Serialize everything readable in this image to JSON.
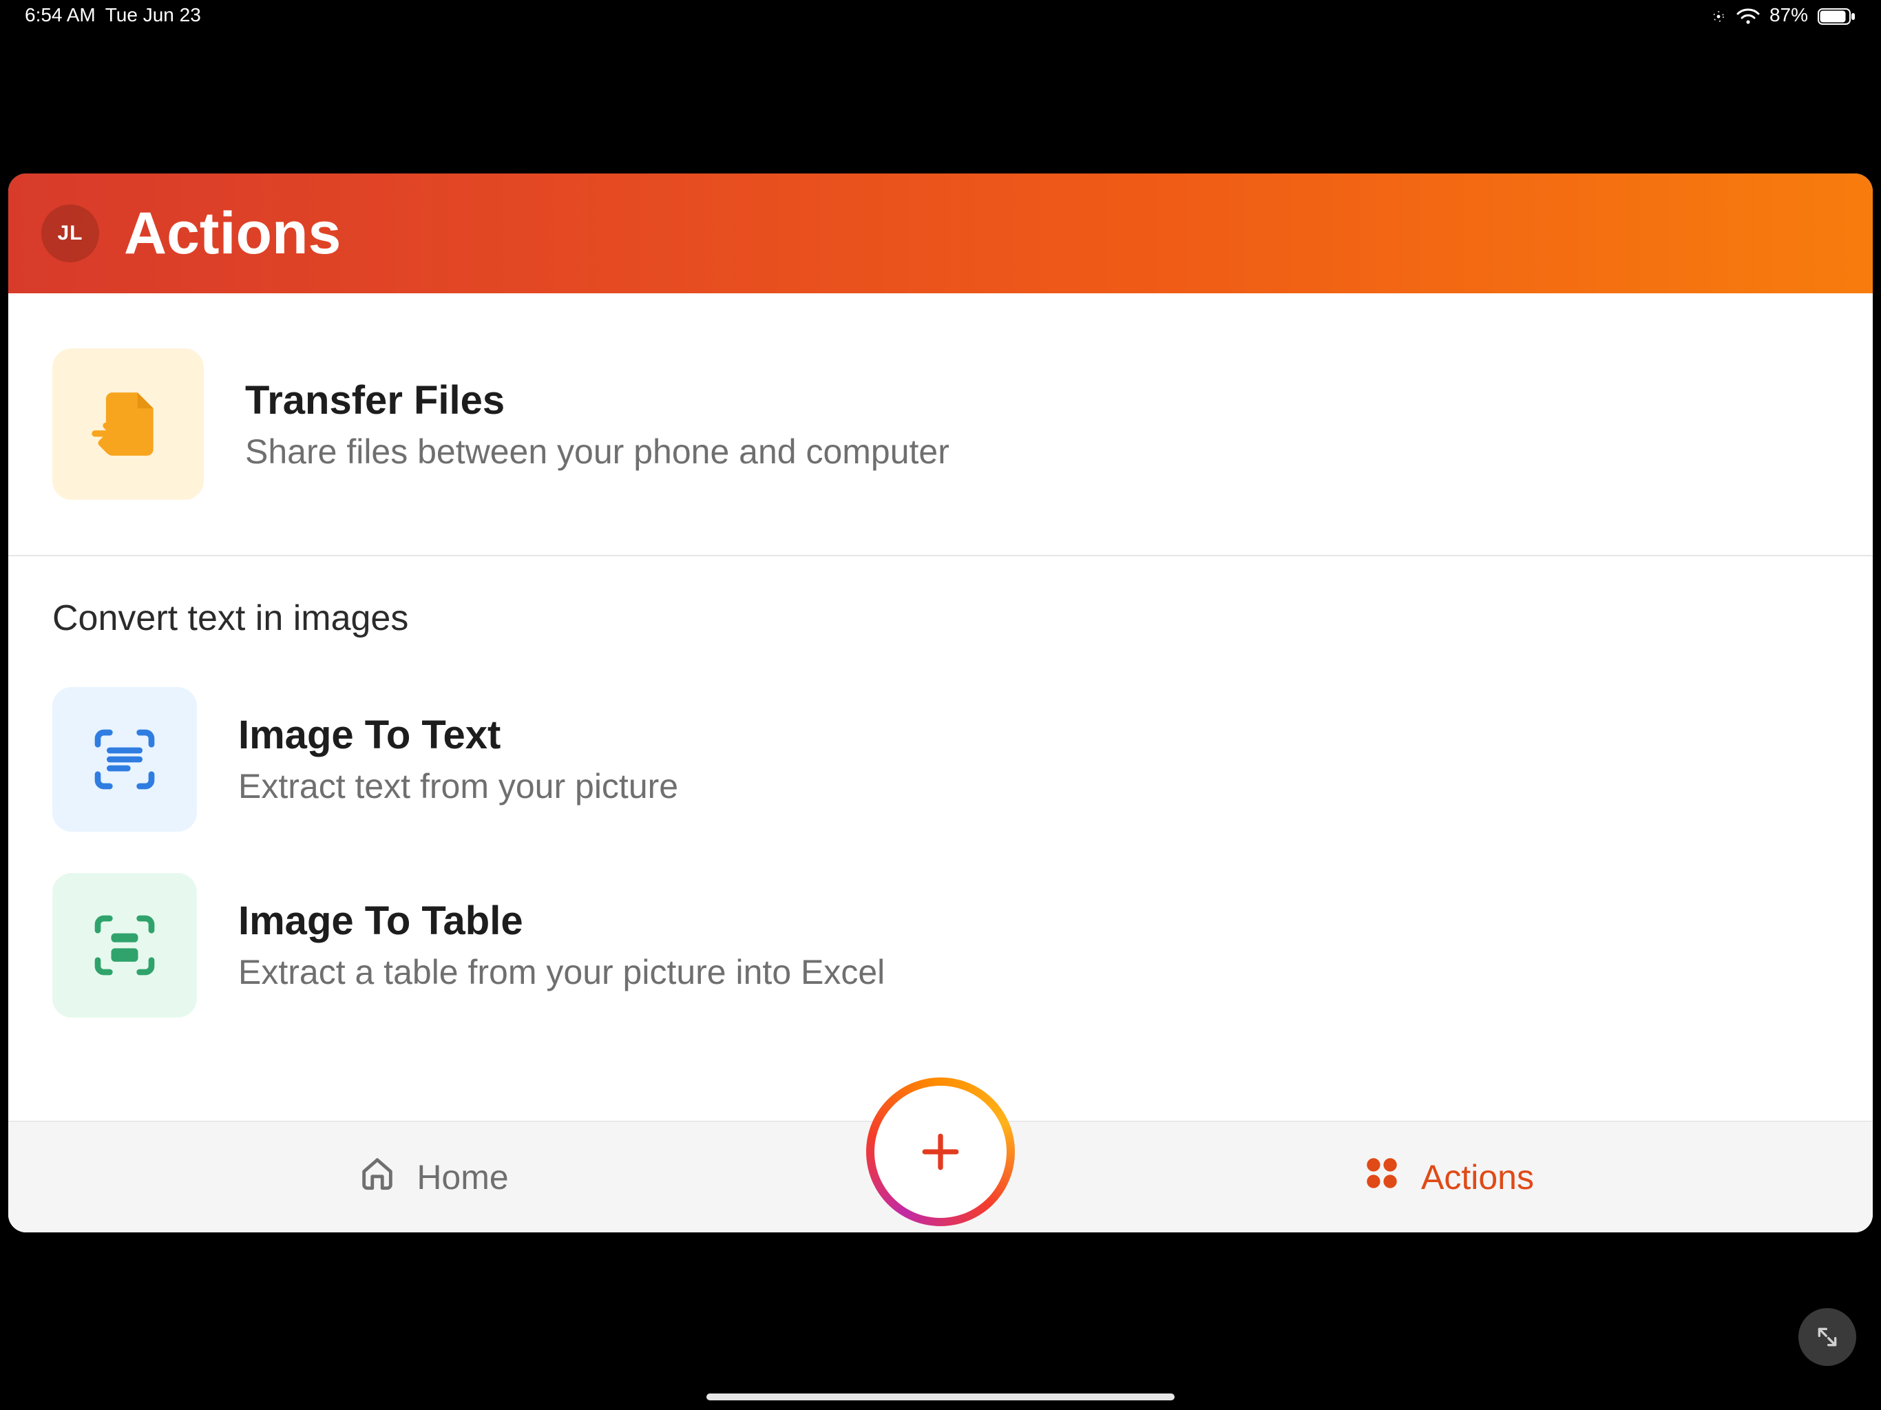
{
  "status_bar": {
    "time": "6:54 AM",
    "date": "Tue Jun 23",
    "battery_pct": "87%"
  },
  "header": {
    "avatar_initials": "JL",
    "title": "Actions"
  },
  "sections": {
    "share": {
      "items": [
        {
          "title": "Transfer Files",
          "subtitle": "Share files between your phone and computer",
          "icon": "transfer-icon"
        }
      ]
    },
    "convert": {
      "label": "Convert text in images",
      "items": [
        {
          "title": "Image To Text",
          "subtitle": "Extract text from your picture",
          "icon": "image-to-text-icon"
        },
        {
          "title": "Image To Table",
          "subtitle": "Extract a table from your picture into Excel",
          "icon": "image-to-table-icon"
        }
      ]
    }
  },
  "tabs": {
    "home": "Home",
    "actions": "Actions"
  }
}
